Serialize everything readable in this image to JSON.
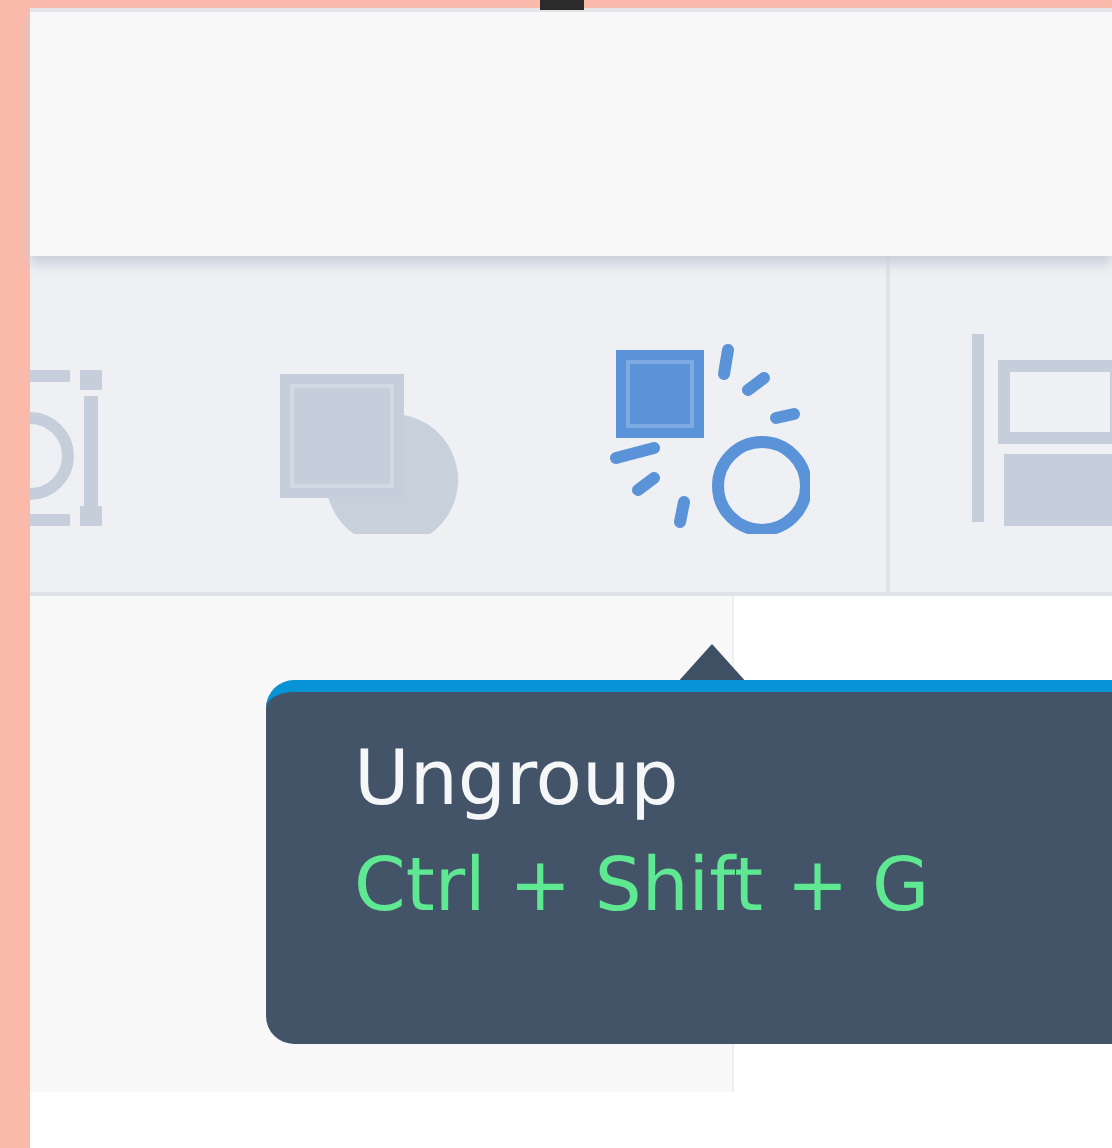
{
  "toolbar": {
    "groups": [
      {
        "tools": [
          {
            "kind": "bounds",
            "active": false
          },
          {
            "kind": "group",
            "active": false
          },
          {
            "kind": "ungroup",
            "active": true
          }
        ]
      },
      {
        "tools": [
          {
            "kind": "align",
            "active": false
          }
        ]
      }
    ]
  },
  "tooltip": {
    "title": "Ungroup",
    "shortcut": "Ctrl + Shift + G"
  }
}
